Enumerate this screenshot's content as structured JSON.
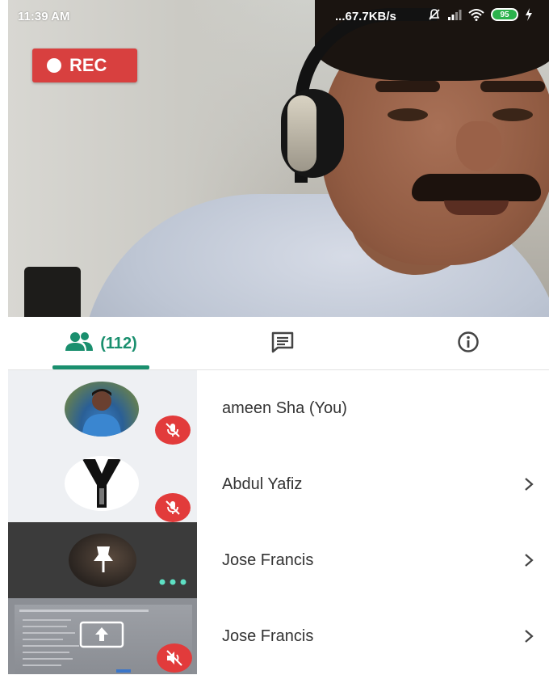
{
  "status_bar": {
    "time": "11:39 AM",
    "net_speed": "...67.7KB/s",
    "icons": [
      "mute-bell-icon",
      "signal-icon",
      "wifi-icon",
      "battery-icon",
      "charging-icon"
    ],
    "battery_level": "95"
  },
  "video": {
    "rec_label": "REC"
  },
  "tabs": {
    "participants_count": "(112)",
    "items": [
      "participants-icon",
      "chat-icon",
      "info-icon"
    ]
  },
  "participants": [
    {
      "name": "ameen Sha (You)",
      "audio": "muted"
    },
    {
      "name": "Abdul Yafiz",
      "audio": "muted"
    },
    {
      "name": "Jose Francis",
      "audio": "more"
    },
    {
      "name": "Jose Francis",
      "audio": "speaker-muted"
    }
  ],
  "colors": {
    "accent": "#1a8f6e",
    "rec": "#d8403f",
    "mute": "#e23b3b"
  }
}
